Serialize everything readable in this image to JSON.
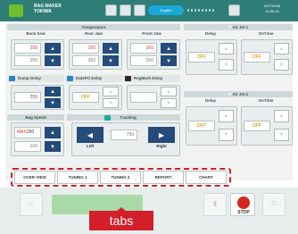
{
  "header": {
    "title_line1": "BAG MAKER",
    "title_line2": "TOKIWA",
    "mode_label": "English",
    "clock_line1": "9/27/2006",
    "clock_line2": "10:00:24"
  },
  "temperature": {
    "section_title": "Temperature",
    "columns": [
      {
        "label": "Back Seal",
        "set": "250",
        "actual": "250"
      },
      {
        "label": "Rear Jaw",
        "set": "260",
        "actual": "260"
      },
      {
        "label": "Front Jaw",
        "set": "260",
        "actual": "260"
      }
    ]
  },
  "options": {
    "dump_delay": "Dump Delay",
    "datepr_delay": "DatePrt Delay",
    "regmark_delay": "RegMark Delay",
    "dump_value": "250",
    "datepr_value": "OFF",
    "regmark_value": ""
  },
  "bag_speed": {
    "label": "Bag Speed",
    "max_prefix": "MAX",
    "max_value": "250",
    "actual": "100"
  },
  "tracking": {
    "label": "Tracking",
    "left_label": "Left",
    "right_label": "Right",
    "value": "799"
  },
  "air_jet1": {
    "title": "Air Jet 1",
    "delay_label": "Delay",
    "ontime_label": "OnTime",
    "delay_value": "OFF",
    "ontime_value": "OFF"
  },
  "air_jet2": {
    "title": "Air Jet 2",
    "delay_label": "Delay",
    "ontime_label": "OnTime",
    "delay_value": "OFF",
    "ontime_value": "OFF"
  },
  "tabs": [
    "OVER VIEW",
    "TUNING 1",
    "TUNING 2",
    "REPORT",
    "CHART"
  ],
  "annotation": {
    "label": "tabs"
  },
  "footer": {
    "stop_label": "STOP"
  },
  "colors": {
    "accent": "#2f7d77",
    "highlight": "#d21f2a",
    "stop": "#d6271f",
    "warn_text": "#e0392e"
  }
}
